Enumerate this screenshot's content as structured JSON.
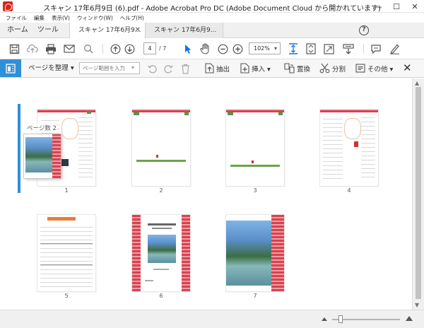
{
  "window": {
    "title": "スキャン 17年6月9日 (6).pdf - Adobe Acrobat Pro DC (Adobe Document Cloud から開かれています)",
    "minimize": "—",
    "maximize": "☐",
    "close": "✕"
  },
  "menubar": {
    "items": [
      "ファイル",
      "編集",
      "表示(V)",
      "ウィンドウ(W)",
      "ヘルプ(H)"
    ]
  },
  "tabs": {
    "home": "ホーム",
    "tools": "ツール",
    "documents": [
      {
        "label": "スキャン 17年6月9...",
        "active": true
      },
      {
        "label": "スキャン 17年6月9...",
        "active": false
      }
    ],
    "help": "?"
  },
  "toolbar": {
    "current_page": "4",
    "total_pages": "/ 7",
    "zoom": "102%"
  },
  "organize": {
    "menu_label": "ページを整理 ▾",
    "range_placeholder": "ページ範囲を入力",
    "extract": "抽出",
    "insert": "挿入 ▾",
    "replace": "置換",
    "split": "分割",
    "more": "その他 ▾"
  },
  "drag": {
    "label": "ページ数 2"
  },
  "pages": [
    {
      "number": "1",
      "kind": "document"
    },
    {
      "number": "2",
      "kind": "green-line"
    },
    {
      "number": "3",
      "kind": "green-line"
    },
    {
      "number": "4",
      "kind": "document"
    },
    {
      "number": "5",
      "kind": "form"
    },
    {
      "number": "6",
      "kind": "cover"
    },
    {
      "number": "7",
      "kind": "photo"
    }
  ],
  "colors": {
    "accent": "#2f8fd8",
    "stripe": "#d9424f",
    "green": "#6aa34a"
  }
}
